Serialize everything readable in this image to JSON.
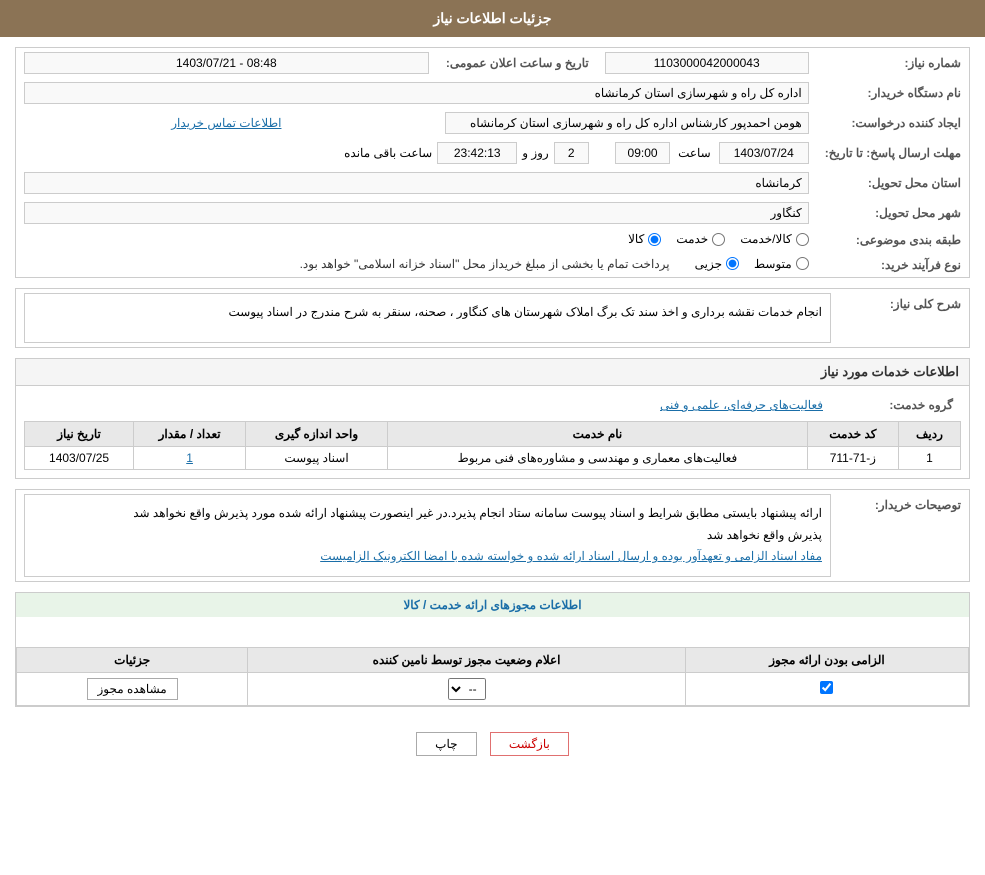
{
  "page": {
    "title": "جزئیات اطلاعات نیاز"
  },
  "header": {
    "need_number_label": "شماره نیاز:",
    "need_number_value": "1103000042000043",
    "buyer_org_label": "نام دستگاه خریدار:",
    "buyer_org_value": "اداره کل راه و شهرسازی استان کرمانشاه",
    "announce_date_label": "تاریخ و ساعت اعلان عمومی:",
    "announce_date_value": "1403/07/21 - 08:48",
    "requester_label": "ایجاد کننده درخواست:",
    "requester_value": "هومن احمدپور کارشناس اداره کل راه و شهرسازی استان کرمانشاه",
    "contact_link": "اطلاعات تماس خریدار",
    "deadline_label": "مهلت ارسال پاسخ: تا تاریخ:",
    "deadline_date": "1403/07/24",
    "deadline_time_label": "ساعت",
    "deadline_time": "09:00",
    "deadline_days_label": "روز و",
    "deadline_days": "2",
    "deadline_remaining_label": "ساعت باقی مانده",
    "deadline_remaining": "23:42:13",
    "province_label": "استان محل تحویل:",
    "province_value": "کرمانشاه",
    "city_label": "شهر محل تحویل:",
    "city_value": "کنگاور",
    "category_label": "طبقه بندی موضوعی:",
    "category_options": [
      "کالا",
      "خدمت",
      "کالا/خدمت"
    ],
    "category_selected": "کالا",
    "process_label": "نوع فرآیند خرید:",
    "process_options": [
      "جزیی",
      "متوسط"
    ],
    "process_selected": "جزیی",
    "process_note": "پرداخت تمام یا بخشی از مبلغ خریداز محل \"اسناد خزانه اسلامی\" خواهد بود."
  },
  "need_description": {
    "section_title": "شرح کلی نیاز:",
    "text": "انجام خدمات نقشه برداری و اخذ سند تک برگ املاک شهرستان های کنگاور ، صحنه، سنقر به شرح مندرج در اسناد پیوست"
  },
  "service_info": {
    "section_title": "اطلاعات خدمات مورد نیاز",
    "service_group_label": "گروه خدمت:",
    "service_group_value": "فعالیت‌های حرفه‌ای، علمی و فنی",
    "table_headers": [
      "ردیف",
      "کد خدمت",
      "نام خدمت",
      "واحد اندازه گیری",
      "تعداد / مقدار",
      "تاریخ نیاز"
    ],
    "table_rows": [
      {
        "row": "1",
        "code": "ز-71-711",
        "name": "فعالیت‌های معماری و مهندسی و مشاوره‌های فنی مربوط",
        "unit": "اسناد پیوست",
        "quantity": "1",
        "date": "1403/07/25"
      }
    ]
  },
  "buyer_description": {
    "section_title": "توصیحات خریدار:",
    "text": "ارائه پیشنهاد بایستی مطابق شرایط و اسناد پیوست سامانه ستاد انجام پذیرد.در غیر اینصورت پیشنهاد ارائه شده مورد پذیرش واقع نخواهد شد\nمفاد اسناد الزامی و تعهدآور بوده و ارسال اسناد ارائه شده و خواسته شده با امضا الکترونیک الزامیست",
    "blue_text": "مفاد اسناد الزامی و تعهدآور بوده و ارسال اسناد ارائه شده و خواسته شده با امضا الکترونیک الزامیست"
  },
  "permissions": {
    "section_title": "اطلاعات مجوزهای ارائه خدمت / کالا",
    "table_headers": [
      "الزامی بودن ارائه مجوز",
      "اعلام وضعیت مجوز توسط نامین کننده",
      "جزئیات"
    ],
    "table_rows": [
      {
        "required": true,
        "status": "--",
        "details_label": "مشاهده مجوز"
      }
    ]
  },
  "footer": {
    "print_label": "چاپ",
    "back_label": "بازگشت"
  }
}
